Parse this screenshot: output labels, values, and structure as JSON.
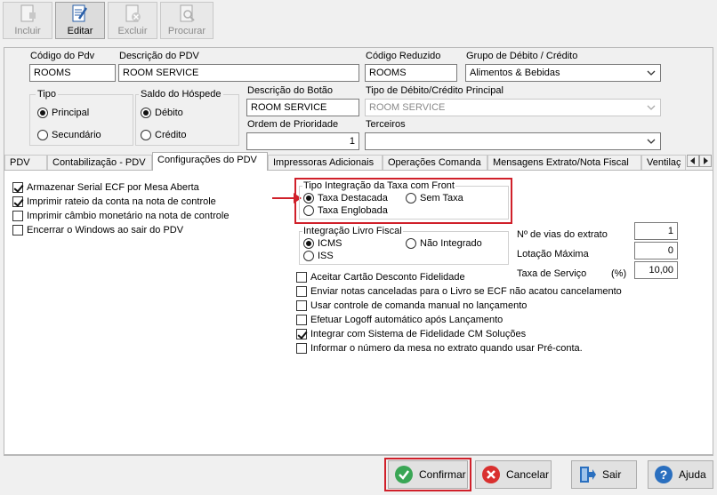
{
  "toolbar": {
    "incluir": "Incluir",
    "editar": "Editar",
    "excluir": "Excluir",
    "procurar": "Procurar"
  },
  "form": {
    "codigo_pdv_label": "Código do Pdv",
    "codigo_pdv": "ROOMS",
    "descricao_pdv_label": "Descrição do PDV",
    "descricao_pdv": "ROOM SERVICE",
    "codigo_reduzido_label": "Código Reduzido",
    "codigo_reduzido": "ROOMS",
    "grupo_label": "Grupo de Débito / Crédito",
    "grupo": "Alimentos & Bebidas",
    "tipo_label": "Tipo",
    "tipo_principal": "Principal",
    "tipo_secundario": "Secundário",
    "saldo_label": "Saldo do Hóspede",
    "saldo_debito": "Débito",
    "saldo_credito": "Crédito",
    "descricao_botao_label": "Descrição do Botão",
    "descricao_botao": "ROOM SERVICE",
    "tipo_debito_label": "Tipo de Débito/Crédito Principal",
    "tipo_debito": "ROOM SERVICE",
    "ordem_label": "Ordem de Prioridade",
    "ordem": "1",
    "terceiros_label": "Terceiros",
    "terceiros": ""
  },
  "tabs": [
    {
      "label": "PDV"
    },
    {
      "label": "Contabilização - PDV"
    },
    {
      "label": "Configurações do PDV"
    },
    {
      "label": "Impressoras Adicionais"
    },
    {
      "label": "Operações Comanda"
    },
    {
      "label": "Mensagens Extrato/Nota Fiscal"
    },
    {
      "label": "Ventilaç"
    }
  ],
  "config": {
    "left_checks": [
      {
        "label": "Armazenar Serial ECF por Mesa Aberta",
        "checked": true
      },
      {
        "label": "Imprimir rateio da conta na nota de controle",
        "checked": true
      },
      {
        "label": "Imprimir câmbio monetário na nota de controle",
        "checked": false
      },
      {
        "label": "Encerrar o Windows ao sair do PDV",
        "checked": false
      }
    ],
    "taxa_group_label": "Tipo Integração da Taxa com Front",
    "taxa_destacada": "Taxa Destacada",
    "sem_taxa": "Sem Taxa",
    "taxa_englobada": "Taxa Englobada",
    "livro_group_label": "Integração Livro Fiscal",
    "icms": "ICMS",
    "nao_integrado": "Não Integrado",
    "iss": "ISS",
    "vias_label": "Nº de vias do extrato",
    "vias": "1",
    "lotacao_label": "Lotação Máxima",
    "lotacao": "0",
    "taxa_servico_label": "Taxa de Serviço",
    "taxa_servico_unit": "(%)",
    "taxa_servico": "10,00",
    "right_checks": [
      {
        "label": "Aceitar Cartão Desconto Fidelidade",
        "checked": false
      },
      {
        "label": "Enviar notas canceladas para o Livro se ECF não acatou cancelamento",
        "checked": false
      },
      {
        "label": "Usar controle de comanda manual no lançamento",
        "checked": false
      },
      {
        "label": "Efetuar Logoff automático após Lançamento",
        "checked": false
      },
      {
        "label": "Integrar com Sistema de Fidelidade CM Soluções",
        "checked": true
      },
      {
        "label": "Informar o número da mesa no extrato quando usar Pré-conta.",
        "checked": false
      }
    ]
  },
  "buttons": {
    "confirmar": "Confirmar",
    "cancelar": "Cancelar",
    "sair": "Sair",
    "ajuda": "Ajuda"
  },
  "colors": {
    "highlight": "#d0202a",
    "confirm_green": "#3aa655",
    "cancel_red": "#d9302f",
    "help_blue": "#2a6fbf"
  }
}
